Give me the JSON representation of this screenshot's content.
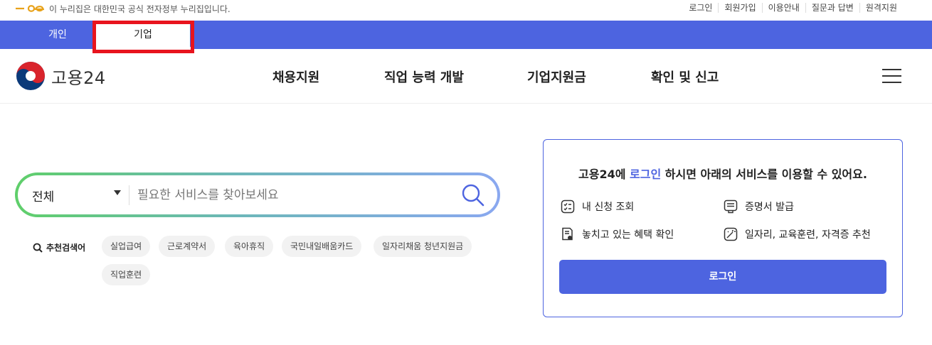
{
  "gov_banner": {
    "text": "이 누리집은 대한민국 공식 전자정부 누리집입니다."
  },
  "util_links": [
    "로그인",
    "회원가입",
    "이용안내",
    "질문과 답변",
    "원격지원"
  ],
  "tabs": [
    {
      "label": "개인"
    },
    {
      "label": "기업"
    }
  ],
  "brand": {
    "name": "고용24"
  },
  "nav": [
    "채용지원",
    "직업 능력 개발",
    "기업지원금",
    "확인 및 신고"
  ],
  "search": {
    "scope": "전체",
    "placeholder": "필요한 서비스를 찾아보세요"
  },
  "recommended": {
    "label": "추천검색어",
    "chips": [
      "실업급여",
      "근로계약서",
      "육아휴직",
      "국민내일배움카드",
      "일자리채움 청년지원금",
      "직업훈련"
    ]
  },
  "login_card": {
    "title_prefix": "고용24에 ",
    "title_highlight": "로그인",
    "title_suffix": " 하시면 아래의 서비스를 이용할 수 있어요.",
    "services": [
      "내 신청 조회",
      "증명서 발급",
      "놓치고 있는 혜택 확인",
      "일자리, 교육훈련, 자격증 추천"
    ],
    "button": "로그인"
  },
  "colors": {
    "primary": "#4d64e0",
    "highlight_box": "#e8141e"
  }
}
